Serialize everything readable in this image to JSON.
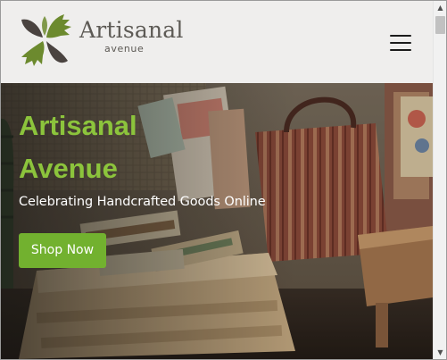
{
  "header": {
    "brand_name": "Artisanal",
    "brand_sub": "avenue",
    "logo_icon": "leaf-logo-icon",
    "menu_icon": "hamburger-menu-icon"
  },
  "hero": {
    "title_line1": "Artisanal",
    "title_line2": "Avenue",
    "tagline": "Celebrating Handcrafted Goods Online",
    "cta_label": "Shop Now"
  },
  "scrollbar": {
    "up_arrow": "▲",
    "down_arrow": "▼"
  },
  "colors": {
    "accent_green": "#8cc43c",
    "button_green": "#72b12f",
    "header_bg": "#efeeed",
    "logo_green": "#6c8a2e",
    "logo_dark": "#4a4340"
  }
}
